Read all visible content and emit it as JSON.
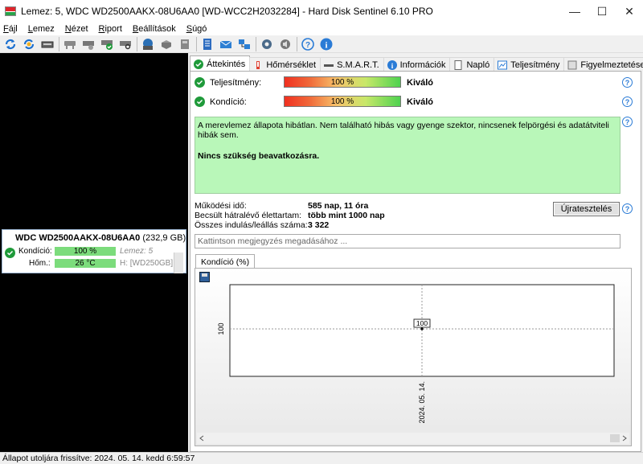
{
  "window": {
    "title": "Lemez: 5, WDC WD2500AAKX-08U6AA0 [WD-WCC2H2032284]  -  Hard Disk Sentinel 6.10 PRO",
    "minimize": "—",
    "maximize": "☐",
    "close": "✕"
  },
  "menu": [
    {
      "label": "Fájl",
      "mnemonic": "F",
      "rest": "ájl"
    },
    {
      "label": "Lemez",
      "mnemonic": "L",
      "rest": "emez"
    },
    {
      "label": "Nézet",
      "mnemonic": "N",
      "rest": "ézet"
    },
    {
      "label": "Riport",
      "mnemonic": "R",
      "rest": "iport"
    },
    {
      "label": "Beállítások",
      "mnemonic": "B",
      "rest": "eállítások"
    },
    {
      "label": "Súgó",
      "mnemonic": "S",
      "rest": "úgó"
    }
  ],
  "toolbar_icons": [
    "refresh-icon",
    "refresh-all-icon",
    "disk-icon",
    "disk-gray-icon",
    "disk-settings-icon",
    "disk-ok-icon",
    "disk-search-icon",
    "disk-save-icon",
    "disk-cd-icon",
    "disk-tools-icon",
    "printer-icon",
    "report-icon",
    "email-icon",
    "network-icon",
    "settings-icon",
    "sound-icon",
    "help-icon",
    "info-icon"
  ],
  "disk_card": {
    "name": "WDC WD2500AAKX-08U6AA0",
    "capacity": "(232,9 GB)",
    "condition_label": "Kondíció:",
    "condition_value": "100 %",
    "disk_label": "Lemez: 5",
    "temp_label": "Hőm.:",
    "temp_value": "26 °C",
    "volume_label": "H: [WD250GB]",
    "condition_fraction": 1.0
  },
  "tabs": [
    {
      "label": "Áttekintés",
      "icon": "ok-icon",
      "active": true
    },
    {
      "label": "Hőmérséklet",
      "icon": "thermometer-icon"
    },
    {
      "label": "S.M.A.R.T.",
      "icon": "smart-icon"
    },
    {
      "label": "Információk",
      "icon": "info-icon"
    },
    {
      "label": "Napló",
      "icon": "log-icon"
    },
    {
      "label": "Teljesítmény",
      "icon": "performance-icon"
    },
    {
      "label": "Figyelmeztetések",
      "icon": "alerts-icon"
    }
  ],
  "overview": {
    "performance_label": "Teljesítmény:",
    "performance_value": "100 %",
    "performance_rating": "Kiváló",
    "health_label": "Kondíció:",
    "health_value": "100 %",
    "health_rating": "Kiváló",
    "message_line1": "A merevlemez állapota hibátlan. Nem található hibás vagy gyenge szektor, nincsenek felpörgési és adatátviteli hibák sem.",
    "message_line2": "Nincs szükség beavatkozásra.",
    "uptime_label": "Működési idő:",
    "uptime_value": "585 nap, 11 óra",
    "remaining_label": "Becsült hátralévő élettartam:",
    "remaining_value": "több mint 1000 nap",
    "startstop_label": "Összes indulás/leállás száma:",
    "startstop_value": "3 322",
    "retest_button": "Újratesztelés",
    "note_placeholder": "Kattintson megjegyzés megadásához ..."
  },
  "chart_tab": "Kondíció  (%)",
  "chart_data": {
    "type": "line",
    "x": [
      "2024. 05. 14."
    ],
    "series": [
      {
        "values": [
          100
        ]
      }
    ],
    "data_labels": [
      "100"
    ],
    "ylabel": "100",
    "grid": true
  },
  "status": "Állapot utoljára frissítve: 2024. 05. 14. kedd 6:59:57",
  "colors": {
    "ok_green": "#1f9a3a",
    "message_bg": "#b9f7b9",
    "disk_bar": "#7cdc7c",
    "accent_blue": "#2a7bd6"
  }
}
